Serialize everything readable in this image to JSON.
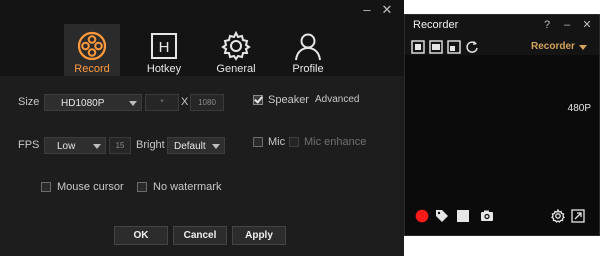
{
  "settings": {
    "window_controls": {
      "min": "–",
      "close": "✕"
    },
    "tabs": [
      {
        "id": "record",
        "label": "Record",
        "icon": "film-reel-icon",
        "active": true
      },
      {
        "id": "hotkey",
        "label": "Hotkey",
        "icon": "key-box-icon",
        "active": false
      },
      {
        "id": "general",
        "label": "General",
        "icon": "gear-icon",
        "active": false
      },
      {
        "id": "profile",
        "label": "Profile",
        "icon": "user-icon",
        "active": false
      }
    ],
    "size": {
      "label": "Size",
      "preset": "HD1080P",
      "width_placeholder": "*",
      "x_sep": "X",
      "height": "1080"
    },
    "speaker": {
      "label": "Speaker",
      "checked": true,
      "advanced": "Advanced"
    },
    "fps": {
      "label": "FPS",
      "value": "Low",
      "number": "15"
    },
    "bright": {
      "label": "Bright",
      "value": "Default"
    },
    "mic": {
      "label": "Mic",
      "checked": false
    },
    "mic_enhance": {
      "label": "Mic enhance",
      "checked": false,
      "disabled": true
    },
    "mouse_cursor": {
      "label": "Mouse cursor",
      "checked": false
    },
    "no_watermark": {
      "label": "No watermark",
      "checked": false
    },
    "buttons": {
      "ok": "OK",
      "cancel": "Cancel",
      "apply": "Apply"
    }
  },
  "recorder": {
    "title": "Recorder",
    "help": "?",
    "min": "–",
    "close": "✕",
    "mode": "Recorder",
    "resolution": "480P",
    "accent_record": "#ff1a1a"
  }
}
